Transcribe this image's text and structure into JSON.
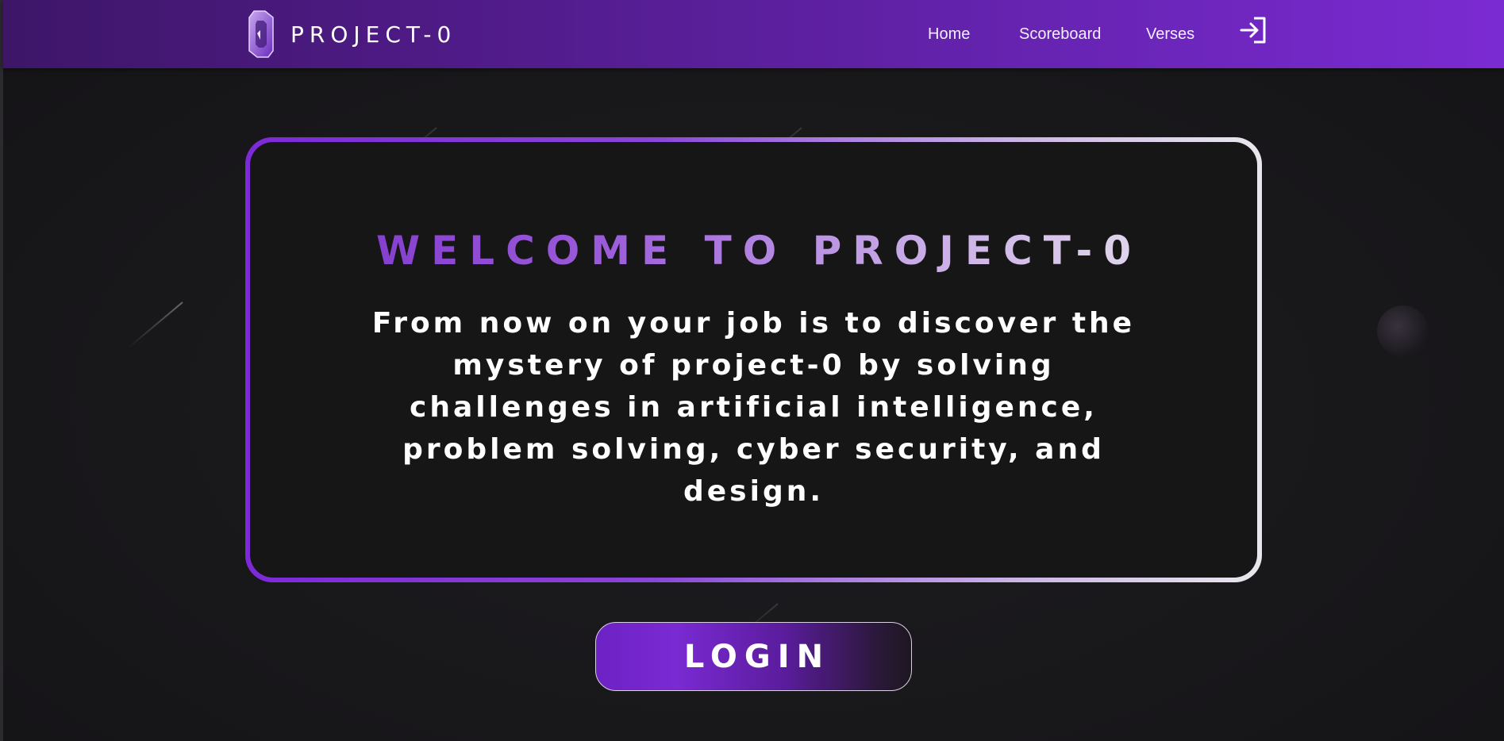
{
  "header": {
    "brand_name": "PROJECT-0",
    "logo_icon": "project-0-logo-icon",
    "nav": [
      {
        "label": "Home"
      },
      {
        "label": "Scoreboard"
      },
      {
        "label": "Verses"
      }
    ],
    "login_icon": "login-arrow-icon"
  },
  "welcome": {
    "title": "WELCOME TO PROJECT-0",
    "text": "From now on your job is to discover the mystery of project-0 by solving challenges in artificial intelligence, problem solving, cyber security, and design."
  },
  "login_button": {
    "label": "LOGIN"
  },
  "colors": {
    "header_start": "#3d1668",
    "header_end": "#7b2bd2",
    "accent_purple": "#7c2ad6",
    "card_bg": "#161617",
    "page_bg": "#1b1a1d"
  }
}
